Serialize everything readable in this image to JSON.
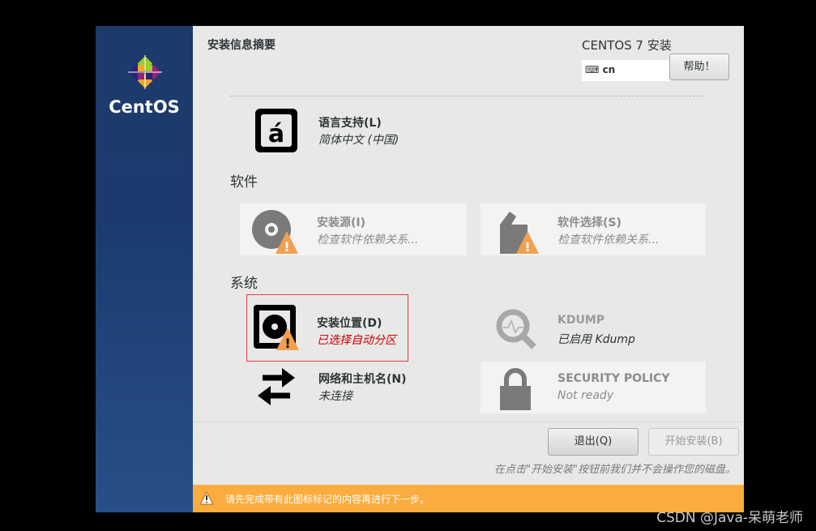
{
  "sidebar": {
    "logo_text": "CentOS"
  },
  "header": {
    "title": "安装信息摘要",
    "product": "CENTOS 7 安装",
    "keyboard_layout": "cn",
    "help_label": "帮助！"
  },
  "localization": {
    "language": {
      "title": "语言支持(L)",
      "status": "简体中文 (中国)"
    }
  },
  "software": {
    "heading": "软件",
    "source": {
      "title": "安装源(I)",
      "status": "检查软件依赖关系..."
    },
    "selection": {
      "title": "软件选择(S)",
      "status": "检查软件依赖关系..."
    }
  },
  "system": {
    "heading": "系统",
    "destination": {
      "title": "安装位置(D)",
      "status": "已选择自动分区"
    },
    "kdump": {
      "title": "KDUMP",
      "status": "已启用 Kdump"
    },
    "network": {
      "title": "网络和主机名(N)",
      "status": "未连接"
    },
    "security": {
      "title": "SECURITY POLICY",
      "status": "Not ready"
    }
  },
  "footer": {
    "quit_label": "退出(Q)",
    "begin_label": "开始安装(B)",
    "note": "在点击\"开始安装\"按钮前我们并不会操作您的磁盘。",
    "warning": "请先完成带有此图标标记的内容再进行下一步。"
  },
  "watermark": "CSDN @Java-呆萌老师",
  "colors": {
    "warning": "#fbac3e",
    "error": "#cc0000",
    "sidebar": "#1c3a6a"
  }
}
